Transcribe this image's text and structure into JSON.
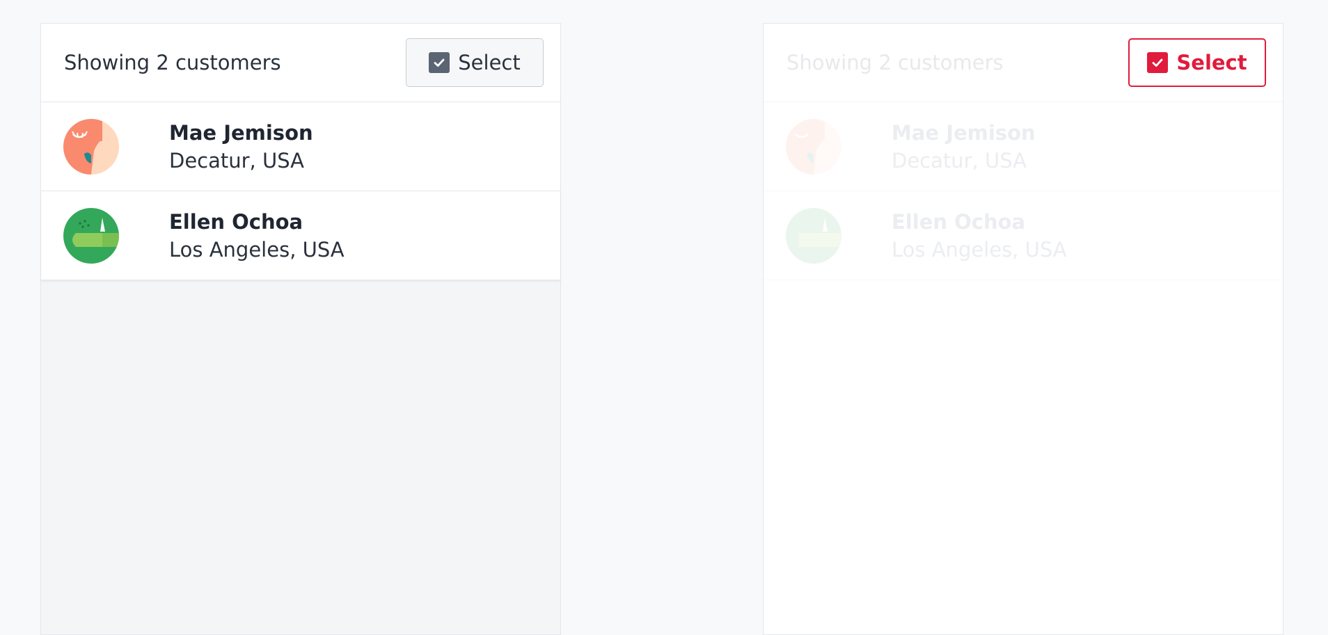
{
  "left_panel": {
    "count_text": "Showing 2 customers",
    "select_label": "Select",
    "customers": [
      {
        "name": "Mae Jemison",
        "location": "Decatur, USA"
      },
      {
        "name": "Ellen Ochoa",
        "location": "Los Angeles, USA"
      }
    ]
  },
  "right_panel": {
    "count_text": "Showing 2 customers",
    "select_label": "Select",
    "customers": [
      {
        "name": "Mae Jemison",
        "location": "Decatur, USA"
      },
      {
        "name": "Ellen Ochoa",
        "location": "Los Angeles, USA"
      }
    ]
  },
  "colors": {
    "select_active": "#e01b3c",
    "select_default_check": "#5b6472",
    "text_primary": "#2a313c"
  },
  "icons": {
    "checkbox": "checkbox-checked-icon",
    "avatar_1": "avatar-orange-illustration",
    "avatar_2": "avatar-green-illustration"
  }
}
